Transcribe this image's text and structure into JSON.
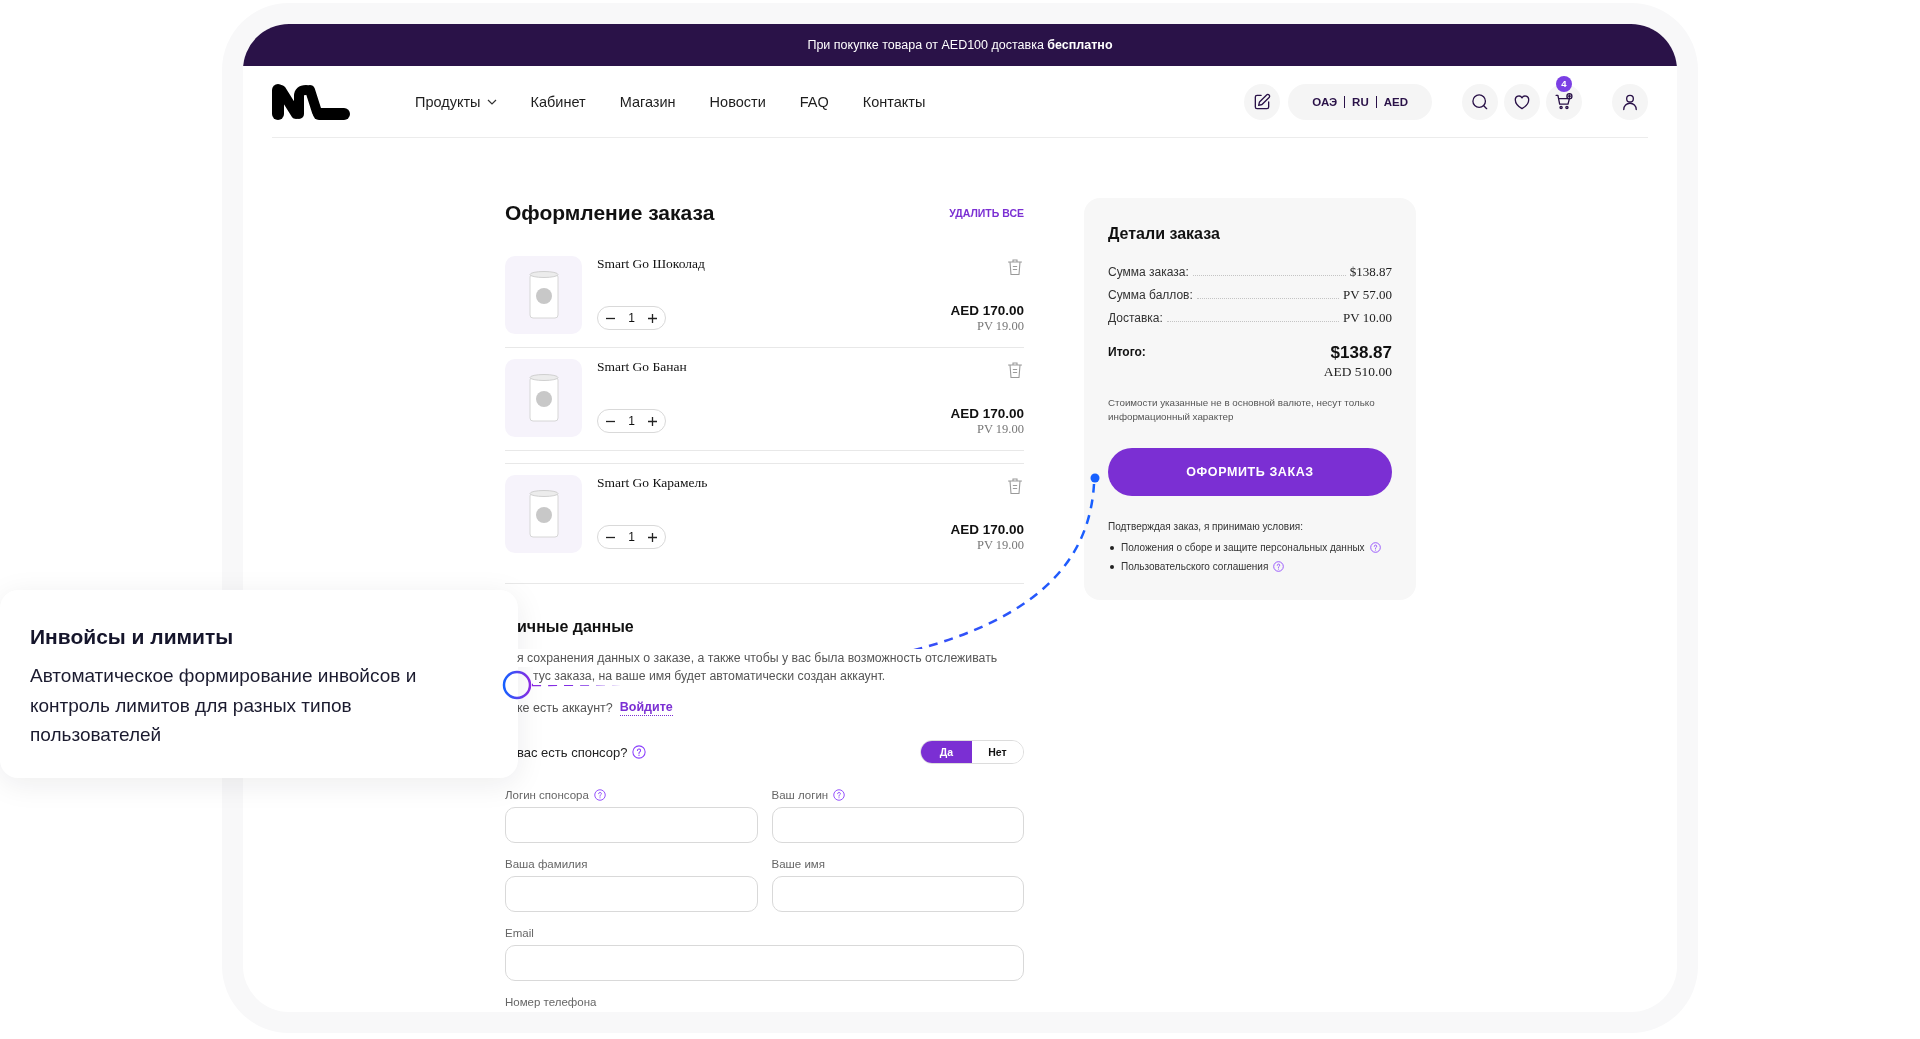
{
  "banner": {
    "text": "При покупке товара от AED100 доставка **бесплатно**"
  },
  "nav": {
    "items": [
      {
        "label": "Продукты",
        "has_menu": true
      },
      {
        "label": "Кабинет",
        "has_menu": false
      },
      {
        "label": "Магазин",
        "has_menu": false
      },
      {
        "label": "Новости",
        "has_menu": false
      },
      {
        "label": "FAQ",
        "has_menu": false
      },
      {
        "label": "Контакты",
        "has_menu": false
      }
    ]
  },
  "header": {
    "locale": [
      "ОАЭ",
      "RU",
      "AED"
    ],
    "cart_count": "4"
  },
  "checkout": {
    "title": "Оформление заказа",
    "clear_all": "УДАЛИТЬ ВСЕ",
    "items": [
      {
        "name": "Smart Go Шоколад",
        "quantity": "1",
        "price": "AED 170.00",
        "points": "PV 19.00"
      },
      {
        "name": "Smart Go Банан",
        "quantity": "1",
        "price": "AED 170.00",
        "points": "PV 19.00"
      },
      {
        "name": "Smart Go Карамель",
        "quantity": "1",
        "price": "AED 170.00",
        "points": "PV 19.00"
      }
    ]
  },
  "personal_data": {
    "title": "ичные данные",
    "intro_lines": [
      "я сохранения данных о заказе, а также чтобы у вас была возможность отслеживать",
      "тус заказа, на ваше имя будет автоматически создан аккаунт."
    ],
    "account_prompt": "ке есть аккаунт?",
    "login_link": "Войдите",
    "sponsor_question": "вас есть спонсор?",
    "sponsor_help": true,
    "sponsor_options": [
      {
        "label": "Да",
        "selected": true
      },
      {
        "label": "Нет",
        "selected": false
      }
    ],
    "field_rows": [
      [
        {
          "label": "Логин спонсора",
          "help": true
        },
        {
          "label": "Ваш логин",
          "help": true
        }
      ],
      [
        {
          "label": "Ваша фамилия",
          "help": false
        },
        {
          "label": "Ваше имя",
          "help": false
        }
      ],
      [
        {
          "label": "Email",
          "help": false
        }
      ],
      [
        {
          "label": "Номер телефона",
          "help": false
        }
      ]
    ]
  },
  "order_details": {
    "title": "Детали заказа",
    "lines": [
      {
        "label": "Сумма заказа:",
        "value": "$138.87"
      },
      {
        "label": "Сумма баллов:",
        "value": "PV 57.00"
      },
      {
        "label": "Доставка:",
        "value": "PV 10.00"
      }
    ],
    "total": {
      "label": "Итого:",
      "value": "$138.87",
      "secondary": "AED 510.00"
    },
    "note": "Стоимости указанные не в основной валюте, несут только информационный характер",
    "submit": "ОФОРМИТЬ ЗАКАЗ",
    "terms_intro": "Подтверждая заказ, я принимаю условия:",
    "terms": [
      {
        "label": "Положения о сборе и защите персональных данных",
        "help": true
      },
      {
        "label": "Пользовательского соглашения",
        "help": true
      }
    ]
  },
  "callout": {
    "title": "Инвойсы и лимиты",
    "text": "Автоматическое формирование инвойсов и контроль лимитов для разных типов пользователей"
  }
}
